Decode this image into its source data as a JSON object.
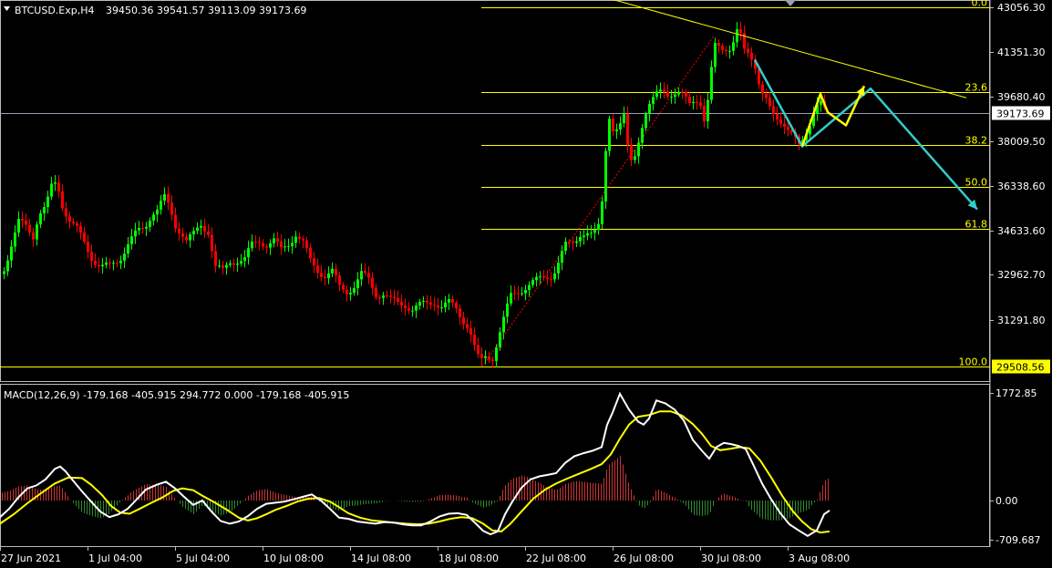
{
  "window": {
    "title": "BTCUSD.Exp,H4",
    "ohlc": "39450.36 39541.57 39113.09 39173.69",
    "collapse_icon": "triangle-down-icon",
    "scroll_marker_icon": "chart-shift-marker-icon"
  },
  "colors": {
    "background": "#000000",
    "bull": "#00ff00",
    "bear": "#ff0000",
    "fibo": "#ffff00",
    "arrow_cyan": "#33cccc",
    "arrow_yellow": "#ffff00",
    "macd_hist_pos": "#cc3333",
    "macd_hist_neg": "#2e8b2e",
    "macd_line": "#ffffff",
    "signal_line": "#ffff00",
    "price_tag_bg": "#ffffff",
    "fibo_tag_bg": "#ffff00",
    "bid_line": "#9aa0b4"
  },
  "price_axis": {
    "ticks": [
      "43056.30",
      "41351.30",
      "39680.40",
      "38009.50",
      "36338.60",
      "34633.60",
      "32962.70",
      "31291.80",
      "29508.56"
    ],
    "current_price": "39173.69",
    "fibo_low_tag": "29508.56"
  },
  "time_axis": {
    "labels": [
      "27 Jun 2021",
      "1 Jul 04:00",
      "5 Jul 04:00",
      "10 Jul 08:00",
      "14 Jul 08:00",
      "18 Jul 08:00",
      "22 Jul 08:00",
      "26 Jul 08:00",
      "30 Jul 08:00",
      "3 Aug 08:00"
    ]
  },
  "fibonacci": {
    "levels": [
      "0.0",
      "23.6",
      "38.2",
      "50.0",
      "61.8",
      "100.0"
    ],
    "ratios": [
      0.0,
      0.236,
      0.382,
      0.5,
      0.618,
      1.0
    ],
    "high": 43200,
    "low": 29508.56
  },
  "macd": {
    "label": "MACD(12,26,9) -179.168 -405.915 294.772 0.000 -179.168 -405.915",
    "ticks": [
      "1772.85",
      "0.00",
      "-709.687"
    ]
  },
  "chart_data": {
    "type": "candlestick",
    "symbol": "BTCUSD.Exp",
    "timeframe": "H4",
    "ylim": [
      29300,
      43200
    ],
    "price_path": [
      [
        0,
        32800
      ],
      [
        6,
        33500
      ],
      [
        12,
        34200
      ],
      [
        20,
        35000
      ],
      [
        28,
        34800
      ],
      [
        36,
        34500
      ],
      [
        42,
        35400
      ],
      [
        50,
        35600
      ],
      [
        56,
        36300
      ],
      [
        62,
        36500
      ],
      [
        68,
        35700
      ],
      [
        76,
        35100
      ],
      [
        84,
        34700
      ],
      [
        92,
        34200
      ],
      [
        100,
        33700
      ],
      [
        110,
        33300
      ],
      [
        120,
        33300
      ],
      [
        130,
        33600
      ],
      [
        140,
        34200
      ],
      [
        150,
        34600
      ],
      [
        158,
        34800
      ],
      [
        166,
        35400
      ],
      [
        172,
        35500
      ],
      [
        180,
        35900
      ],
      [
        186,
        35500
      ],
      [
        192,
        34900
      ],
      [
        198,
        34700
      ],
      [
        204,
        34300
      ],
      [
        212,
        34500
      ],
      [
        220,
        34900
      ],
      [
        228,
        34700
      ],
      [
        236,
        33300
      ],
      [
        244,
        33100
      ],
      [
        252,
        33500
      ],
      [
        260,
        33600
      ],
      [
        268,
        33600
      ],
      [
        276,
        34100
      ],
      [
        284,
        34300
      ],
      [
        292,
        34200
      ],
      [
        300,
        34300
      ],
      [
        308,
        33900
      ],
      [
        316,
        34200
      ],
      [
        324,
        34600
      ],
      [
        332,
        34200
      ],
      [
        340,
        33500
      ],
      [
        348,
        33200
      ],
      [
        356,
        33000
      ],
      [
        364,
        33100
      ],
      [
        372,
        32500
      ],
      [
        380,
        32400
      ],
      [
        388,
        32600
      ],
      [
        396,
        33000
      ],
      [
        404,
        32800
      ],
      [
        412,
        32300
      ],
      [
        420,
        32300
      ],
      [
        428,
        32000
      ],
      [
        436,
        31900
      ],
      [
        444,
        31900
      ],
      [
        452,
        31700
      ],
      [
        460,
        31800
      ],
      [
        468,
        31900
      ],
      [
        476,
        32000
      ],
      [
        484,
        31800
      ],
      [
        492,
        31900
      ],
      [
        500,
        31700
      ],
      [
        508,
        31300
      ],
      [
        514,
        31000
      ],
      [
        520,
        30200
      ],
      [
        526,
        29600
      ],
      [
        532,
        29900
      ],
      [
        540,
        29900
      ],
      [
        548,
        30800
      ],
      [
        554,
        31500
      ],
      [
        560,
        32200
      ],
      [
        566,
        32400
      ],
      [
        574,
        32500
      ],
      [
        582,
        32600
      ],
      [
        590,
        32800
      ],
      [
        598,
        33000
      ],
      [
        606,
        33000
      ],
      [
        612,
        33400
      ],
      [
        620,
        34100
      ],
      [
        628,
        34300
      ],
      [
        636,
        34600
      ],
      [
        644,
        34500
      ],
      [
        650,
        34400
      ],
      [
        656,
        34900
      ],
      [
        662,
        36400
      ],
      [
        666,
        39400
      ],
      [
        672,
        38500
      ],
      [
        678,
        38400
      ],
      [
        684,
        39000
      ],
      [
        690,
        37400
      ],
      [
        696,
        37700
      ],
      [
        702,
        38400
      ],
      [
        708,
        39000
      ],
      [
        714,
        39500
      ],
      [
        720,
        40000
      ],
      [
        726,
        40300
      ],
      [
        732,
        39900
      ],
      [
        738,
        39700
      ],
      [
        744,
        39800
      ],
      [
        750,
        39900
      ],
      [
        756,
        39700
      ],
      [
        762,
        39800
      ],
      [
        768,
        39400
      ],
      [
        772,
        38700
      ],
      [
        778,
        39900
      ],
      [
        782,
        41800
      ],
      [
        786,
        42000
      ],
      [
        790,
        41800
      ],
      [
        796,
        41600
      ],
      [
        802,
        41400
      ],
      [
        806,
        42000
      ],
      [
        810,
        42400
      ],
      [
        816,
        41700
      ],
      [
        822,
        41600
      ],
      [
        828,
        40900
      ],
      [
        834,
        39800
      ],
      [
        840,
        39600
      ],
      [
        846,
        39300
      ],
      [
        852,
        39100
      ],
      [
        858,
        38800
      ],
      [
        864,
        38400
      ],
      [
        870,
        38200
      ],
      [
        876,
        38000
      ],
      [
        882,
        38400
      ],
      [
        888,
        38800
      ],
      [
        894,
        39300
      ],
      [
        900,
        39450
      ],
      [
        906,
        39173
      ]
    ],
    "fibo_anchor": {
      "high": 43200,
      "low": 29508.56
    },
    "trendline": {
      "from": [
        672,
        43500
      ],
      "to": [
        1060,
        39750
      ]
    },
    "projection_cyan": [
      [
        828,
        41200
      ],
      [
        880,
        37900
      ],
      [
        955,
        40100
      ],
      [
        1072,
        35500
      ]
    ],
    "projection_yellow": [
      [
        880,
        37900
      ],
      [
        900,
        39900
      ],
      [
        908,
        39200
      ],
      [
        928,
        38700
      ],
      [
        948,
        40200
      ]
    ],
    "macd_path": [
      [
        0,
        -300
      ],
      [
        10,
        -150
      ],
      [
        20,
        50
      ],
      [
        30,
        200
      ],
      [
        40,
        250
      ],
      [
        50,
        350
      ],
      [
        60,
        520
      ],
      [
        66,
        560
      ],
      [
        72,
        480
      ],
      [
        80,
        330
      ],
      [
        90,
        150
      ],
      [
        100,
        -20
      ],
      [
        110,
        -200
      ],
      [
        120,
        -300
      ],
      [
        130,
        -250
      ],
      [
        140,
        -150
      ],
      [
        150,
        20
      ],
      [
        160,
        180
      ],
      [
        172,
        260
      ],
      [
        182,
        310
      ],
      [
        192,
        200
      ],
      [
        202,
        60
      ],
      [
        212,
        -80
      ],
      [
        222,
        0
      ],
      [
        232,
        -200
      ],
      [
        242,
        -370
      ],
      [
        252,
        -420
      ],
      [
        262,
        -380
      ],
      [
        272,
        -280
      ],
      [
        282,
        -150
      ],
      [
        292,
        -60
      ],
      [
        302,
        -40
      ],
      [
        312,
        -20
      ],
      [
        322,
        20
      ],
      [
        332,
        60
      ],
      [
        342,
        100
      ],
      [
        352,
        0
      ],
      [
        362,
        -150
      ],
      [
        372,
        -310
      ],
      [
        382,
        -330
      ],
      [
        392,
        -380
      ],
      [
        402,
        -400
      ],
      [
        412,
        -420
      ],
      [
        422,
        -390
      ],
      [
        432,
        -400
      ],
      [
        442,
        -430
      ],
      [
        452,
        -450
      ],
      [
        462,
        -450
      ],
      [
        472,
        -380
      ],
      [
        482,
        -290
      ],
      [
        492,
        -240
      ],
      [
        502,
        -230
      ],
      [
        512,
        -260
      ],
      [
        522,
        -420
      ],
      [
        530,
        -550
      ],
      [
        538,
        -610
      ],
      [
        546,
        -560
      ],
      [
        554,
        -250
      ],
      [
        562,
        -20
      ],
      [
        572,
        210
      ],
      [
        582,
        350
      ],
      [
        592,
        400
      ],
      [
        600,
        420
      ],
      [
        610,
        450
      ],
      [
        620,
        620
      ],
      [
        630,
        730
      ],
      [
        640,
        780
      ],
      [
        650,
        820
      ],
      [
        660,
        880
      ],
      [
        666,
        1250
      ],
      [
        672,
        1450
      ],
      [
        680,
        1760
      ],
      [
        690,
        1500
      ],
      [
        700,
        1300
      ],
      [
        706,
        1250
      ],
      [
        712,
        1350
      ],
      [
        720,
        1650
      ],
      [
        730,
        1600
      ],
      [
        740,
        1500
      ],
      [
        750,
        1320
      ],
      [
        760,
        1000
      ],
      [
        770,
        820
      ],
      [
        778,
        690
      ],
      [
        786,
        880
      ],
      [
        794,
        950
      ],
      [
        802,
        930
      ],
      [
        810,
        900
      ],
      [
        818,
        850
      ],
      [
        826,
        600
      ],
      [
        836,
        280
      ],
      [
        846,
        20
      ],
      [
        856,
        -230
      ],
      [
        866,
        -430
      ],
      [
        876,
        -540
      ],
      [
        886,
        -640
      ],
      [
        896,
        -540
      ],
      [
        904,
        -250
      ],
      [
        910,
        -180
      ]
    ],
    "signal_path": [
      [
        0,
        -420
      ],
      [
        15,
        -250
      ],
      [
        30,
        -50
      ],
      [
        45,
        120
      ],
      [
        60,
        280
      ],
      [
        75,
        380
      ],
      [
        90,
        370
      ],
      [
        100,
        260
      ],
      [
        112,
        90
      ],
      [
        122,
        -100
      ],
      [
        132,
        -220
      ],
      [
        142,
        -240
      ],
      [
        152,
        -160
      ],
      [
        165,
        -50
      ],
      [
        178,
        50
      ],
      [
        190,
        160
      ],
      [
        200,
        200
      ],
      [
        212,
        170
      ],
      [
        222,
        80
      ],
      [
        236,
        -40
      ],
      [
        250,
        -180
      ],
      [
        262,
        -310
      ],
      [
        272,
        -360
      ],
      [
        282,
        -320
      ],
      [
        292,
        -250
      ],
      [
        302,
        -170
      ],
      [
        314,
        -100
      ],
      [
        326,
        -20
      ],
      [
        338,
        30
      ],
      [
        350,
        40
      ],
      [
        362,
        -20
      ],
      [
        372,
        -120
      ],
      [
        382,
        -230
      ],
      [
        395,
        -310
      ],
      [
        408,
        -360
      ],
      [
        420,
        -380
      ],
      [
        432,
        -400
      ],
      [
        445,
        -420
      ],
      [
        458,
        -430
      ],
      [
        470,
        -420
      ],
      [
        482,
        -380
      ],
      [
        494,
        -330
      ],
      [
        506,
        -300
      ],
      [
        518,
        -320
      ],
      [
        530,
        -420
      ],
      [
        540,
        -540
      ],
      [
        550,
        -560
      ],
      [
        560,
        -420
      ],
      [
        572,
        -200
      ],
      [
        585,
        30
      ],
      [
        598,
        180
      ],
      [
        610,
        280
      ],
      [
        622,
        360
      ],
      [
        635,
        440
      ],
      [
        648,
        520
      ],
      [
        660,
        600
      ],
      [
        670,
        760
      ],
      [
        680,
        1020
      ],
      [
        690,
        1250
      ],
      [
        700,
        1380
      ],
      [
        712,
        1410
      ],
      [
        724,
        1470
      ],
      [
        736,
        1470
      ],
      [
        748,
        1400
      ],
      [
        760,
        1260
      ],
      [
        770,
        1100
      ],
      [
        780,
        900
      ],
      [
        790,
        830
      ],
      [
        800,
        850
      ],
      [
        812,
        880
      ],
      [
        822,
        860
      ],
      [
        834,
        660
      ],
      [
        846,
        380
      ],
      [
        858,
        80
      ],
      [
        870,
        -200
      ],
      [
        880,
        -380
      ],
      [
        890,
        -520
      ],
      [
        900,
        -580
      ],
      [
        910,
        -560
      ]
    ]
  }
}
